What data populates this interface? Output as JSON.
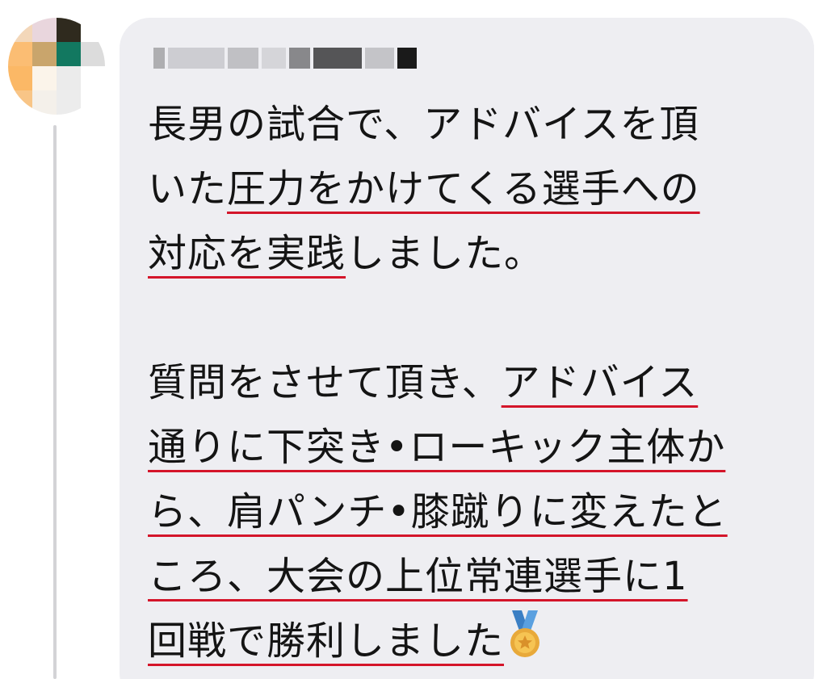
{
  "comment": {
    "author_name_redacted": true,
    "lines": [
      {
        "pre": "長男の試合で、アドバイスを頂",
        "ul": "",
        "post": ""
      },
      {
        "pre": "いた",
        "ul": "圧力をかけてくる選手への",
        "post": ""
      },
      {
        "pre": "",
        "ul": "対応を実践",
        "post": "しました。"
      },
      {
        "pre": "質問をさせて頂き、",
        "ul": "アドバイス",
        "post": ""
      },
      {
        "pre": "",
        "ul": "通りに下突き•ローキック主体か",
        "post": ""
      },
      {
        "pre": "",
        "ul": "ら、肩パンチ•膝蹴りに変えたと",
        "post": ""
      },
      {
        "pre": "",
        "ul": "ころ、大会の上位常連選手に1",
        "post": ""
      },
      {
        "pre": "",
        "ul": "回戦で勝利しました",
        "post": ""
      }
    ],
    "emoji": "medal-icon"
  },
  "colors": {
    "bubble_bg": "#eeeef2",
    "text": "#141414",
    "underline": "#d4152a",
    "thread_line": "#d3d3d6"
  }
}
